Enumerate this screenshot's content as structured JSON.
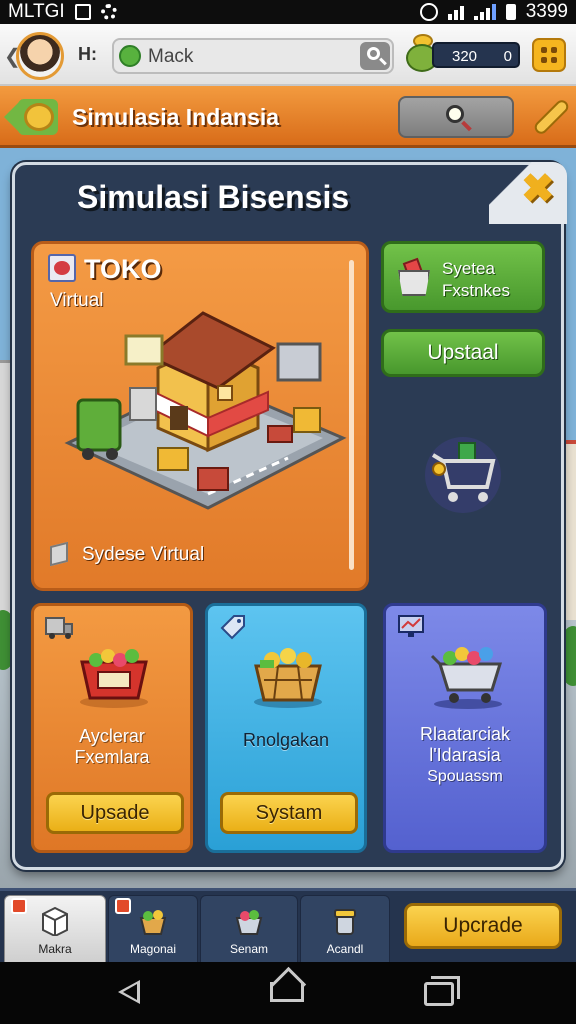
{
  "status_bar": {
    "carrier": "MLTGI",
    "time": "3399",
    "icons": [
      "image-icon",
      "gear-icon",
      "alarm-icon",
      "wifi-icon",
      "signal-icon",
      "battery-icon"
    ]
  },
  "header": {
    "greeting": "H:",
    "player_name": "Mack",
    "coins": "320",
    "gems": "0",
    "icons": [
      "avatar",
      "leaf-icon",
      "search-icon",
      "coin-pot-icon",
      "menu-grid-icon"
    ]
  },
  "titlebar": {
    "title": "Simulasia Indansia",
    "icons": [
      "back-coin-icon",
      "magnifier-icon",
      "bandage-icon"
    ]
  },
  "panel": {
    "title": "Simulasi Bisensis",
    "close_icon": "close-icon"
  },
  "toko_card": {
    "title": "TOKO",
    "subtitle": "Virtual",
    "footer": "Sydese Virtual"
  },
  "side_buttons": {
    "system_label_line1": "Syetea",
    "system_label_line2": "Fxstnkes",
    "upstaal_label": "Upstaal"
  },
  "cards": [
    {
      "label_line1": "Ayclerar",
      "label_line2": "Fxemlara",
      "button": "Upsade",
      "color": "#f39a42"
    },
    {
      "label_line1": "Rnolgakan",
      "button": "Systam",
      "color": "#5dc4f0"
    },
    {
      "label_line1": "Rlaatarciak",
      "label_line2": "l'Idarasia",
      "label_line3": "Spouassm",
      "color": "#7d89e8"
    }
  ],
  "bottom_nav": {
    "tabs": [
      {
        "label": "Makra"
      },
      {
        "label": "Magonai"
      },
      {
        "label": "Senam"
      },
      {
        "label": "Acandl"
      }
    ],
    "upgrade_label": "Upcrade"
  },
  "colors": {
    "accent_orange": "#e17a29",
    "accent_green": "#48982d",
    "button_yellow": "#eab017",
    "panel_dark": "#2b3b54"
  }
}
